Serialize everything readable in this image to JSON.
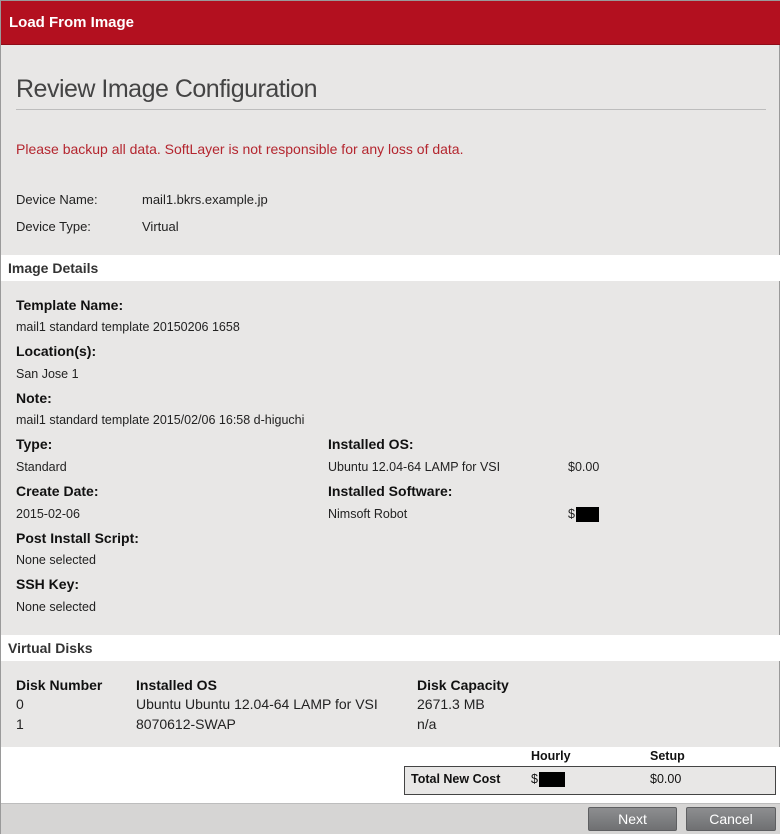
{
  "dialog": {
    "title": "Load From Image"
  },
  "review": {
    "title": "Review Image Configuration",
    "warning": "Please backup all data. SoftLayer is not responsible for any loss of data.",
    "device_name_label": "Device Name:",
    "device_name": "mail1.bkrs.example.jp",
    "device_type_label": "Device Type:",
    "device_type": "Virtual"
  },
  "image_details": {
    "heading": "Image Details",
    "template_name_label": "Template Name:",
    "template_name": "mail1 standard template 20150206 1658",
    "locations_label": "Location(s):",
    "locations": "San Jose 1",
    "note_label": "Note:",
    "note": "mail1 standard template 2015/02/06 16:58 d-higuchi",
    "type_label": "Type:",
    "type": "Standard",
    "create_date_label": "Create Date:",
    "create_date": "2015-02-06",
    "post_install_label": "Post Install Script:",
    "post_install": "None selected",
    "ssh_key_label": "SSH Key:",
    "ssh_key": "None selected",
    "installed_os_label": "Installed OS:",
    "installed_os": "Ubuntu 12.04-64 LAMP for VSI",
    "installed_os_price": "$0.00",
    "installed_software_label": "Installed Software:",
    "installed_software": "Nimsoft Robot",
    "installed_software_price_prefix": "$"
  },
  "virtual_disks": {
    "heading": "Virtual Disks",
    "columns": [
      "Disk Number",
      "Installed OS",
      "Disk Capacity"
    ],
    "rows": [
      [
        "0",
        "Ubuntu Ubuntu 12.04-64 LAMP for VSI",
        "2671.3 MB"
      ],
      [
        "1",
        "8070612-SWAP",
        "n/a"
      ]
    ]
  },
  "cost": {
    "hourly_header": "Hourly",
    "setup_header": "Setup",
    "total_label": "Total New Cost",
    "hourly_prefix": "$",
    "setup": "$0.00"
  },
  "footer": {
    "next_label": "Next",
    "cancel_label": "Cancel"
  }
}
